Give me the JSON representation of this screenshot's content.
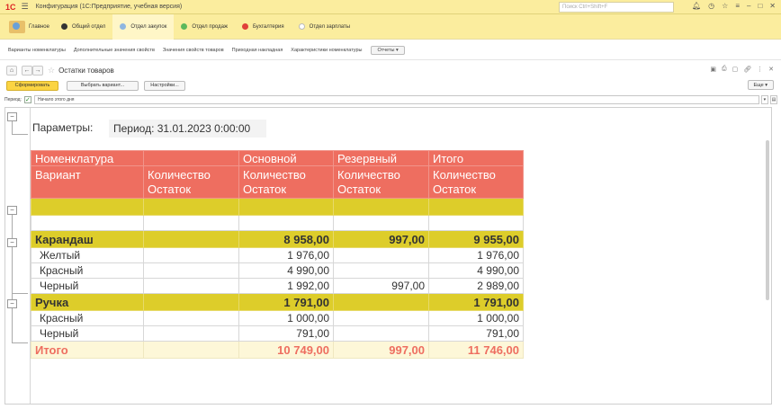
{
  "app": {
    "logo": "1С",
    "title": "Конфигурация (1С:Предприятие, учебная версия)",
    "search_placeholder": "Поиск Ctrl+Shift+F"
  },
  "sections": [
    {
      "label": "Главное",
      "color": "#e8c06a"
    },
    {
      "label": "Общий отдел",
      "color": "#333333"
    },
    {
      "label": "Отдел закупок",
      "color": "#8fb6e0",
      "active": true
    },
    {
      "label": "Отдел продаж",
      "color": "#5cb85c"
    },
    {
      "label": "Бухгалтерия",
      "color": "#e0403a"
    },
    {
      "label": "Отдел зарплаты",
      "color": "#ffffff"
    }
  ],
  "subnav": {
    "links": [
      "Варианты номенклатуры",
      "Дополнительные значения свойств",
      "Значения свойств товаров",
      "Приходная накладная",
      "Характеристики номенклатуры"
    ],
    "reports_label": "Отчеты"
  },
  "page": {
    "title": "Остатки товаров",
    "generate_label": "Сформировать",
    "variant_label": "Выбрать вариант...",
    "settings_label": "Настройки...",
    "more_label": "Еще"
  },
  "period": {
    "label": "Период:",
    "value": "Начало этого дня"
  },
  "report": {
    "params_label": "Параметры:",
    "params_value": "Период: 31.01.2023 0:00:00",
    "header": {
      "col1a": "Номенклатура",
      "col1b": "Вариант",
      "col2b": "Количество Остаток",
      "col3a": "Основной",
      "col3b": "Количество Остаток",
      "col4a": "Резервный",
      "col4b": "Количество Остаток",
      "col5a": "Итого",
      "col5b": "Количество Остаток"
    },
    "groups": [
      {
        "name": "Карандаш",
        "main": "8 958,00",
        "reserve": "997,00",
        "total": "9 955,00",
        "rows": [
          {
            "name": "Желтый",
            "main": "1 976,00",
            "reserve": "",
            "total": "1 976,00"
          },
          {
            "name": "Красный",
            "main": "4 990,00",
            "reserve": "",
            "total": "4 990,00"
          },
          {
            "name": "Черный",
            "main": "1 992,00",
            "reserve": "997,00",
            "total": "2 989,00"
          }
        ]
      },
      {
        "name": "Ручка",
        "main": "1 791,00",
        "reserve": "",
        "total": "1 791,00",
        "rows": [
          {
            "name": "Красный",
            "main": "1 000,00",
            "reserve": "",
            "total": "1 000,00"
          },
          {
            "name": "Черный",
            "main": "791,00",
            "reserve": "",
            "total": "791,00"
          }
        ]
      }
    ],
    "grand_total": {
      "label": "Итого",
      "main": "10 749,00",
      "reserve": "997,00",
      "total": "11 746,00"
    }
  }
}
